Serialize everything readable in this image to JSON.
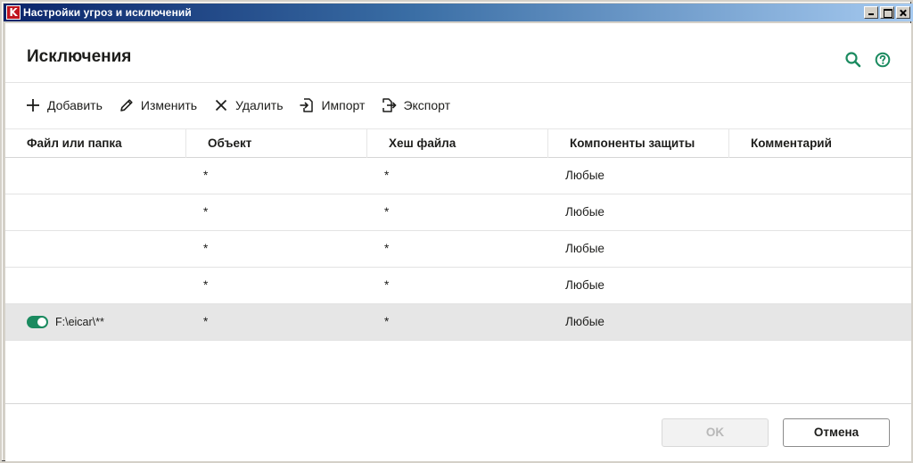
{
  "window": {
    "title": "Настройки угроз и исключений",
    "icon_letter": "K",
    "colors": {
      "titlebar": "#0a246a",
      "accent": "#1a8a5f",
      "icon": "#c0141e"
    }
  },
  "header": {
    "title": "Исключения",
    "icons": [
      "search-icon",
      "help-icon"
    ]
  },
  "toolbar": {
    "add_label": "Добавить",
    "edit_label": "Изменить",
    "delete_label": "Удалить",
    "import_label": "Импорт",
    "export_label": "Экспорт"
  },
  "table": {
    "columns": [
      "Файл или папка",
      "Объект",
      "Хеш файла",
      "Компоненты защиты",
      "Комментарий"
    ],
    "rows": [
      {
        "file": "",
        "object": "*",
        "hash": "*",
        "components": "Любые",
        "comment": "",
        "enabled": null
      },
      {
        "file": "",
        "object": "*",
        "hash": "*",
        "components": "Любые",
        "comment": "",
        "enabled": null
      },
      {
        "file": "",
        "object": "*",
        "hash": "*",
        "components": "Любые",
        "comment": "",
        "enabled": null
      },
      {
        "file": "",
        "object": "*",
        "hash": "*",
        "components": "Любые",
        "comment": "",
        "enabled": null
      },
      {
        "file": "F:\\eicar\\**",
        "object": "*",
        "hash": "*",
        "components": "Любые",
        "comment": "",
        "enabled": true
      }
    ]
  },
  "footer": {
    "ok_label": "OK",
    "cancel_label": "Отмена"
  }
}
